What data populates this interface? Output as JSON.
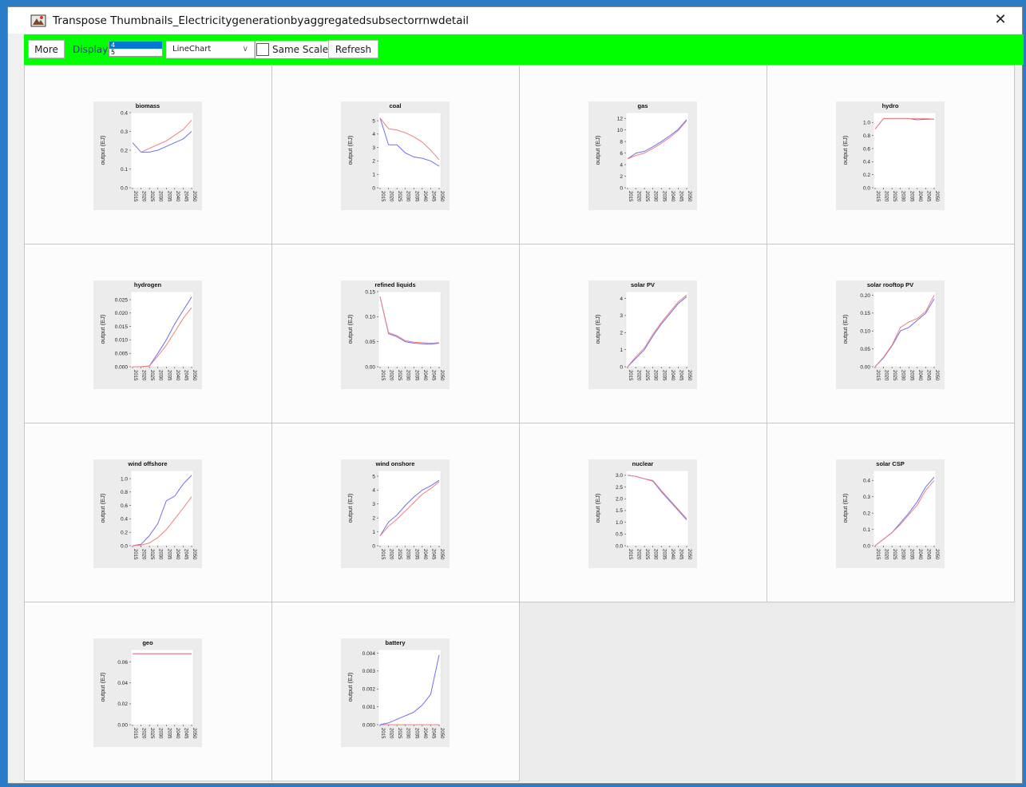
{
  "window": {
    "title": "Transpose Thumbnails_Electricitygenerationbyaggregatedsubsectorrnwdetail",
    "close_glyph": "✕"
  },
  "toolbar": {
    "more_label": "More",
    "display_label": "Display",
    "display_options": [
      "4",
      "5"
    ],
    "display_selected": "4",
    "chart_type": "LineChart",
    "same_scale_label": "Same Scale",
    "same_scale_checked": false,
    "refresh_label": "Refresh",
    "background_color": "#00ff00"
  },
  "chart_data": [
    {
      "type": "line",
      "title": "biomass",
      "ylabel": "output (EJ)",
      "x": [
        "2015",
        "2020",
        "2025",
        "2030",
        "2035",
        "2040",
        "2045",
        "2050"
      ],
      "yticks": [
        "0.0",
        "0.1",
        "0.2",
        "0.3",
        "0.4"
      ],
      "ylim": [
        0,
        0.4
      ],
      "series": [
        {
          "color": "#6f6fee",
          "values": [
            0.24,
            0.19,
            0.19,
            0.2,
            0.22,
            0.24,
            0.26,
            0.3
          ]
        },
        {
          "color": "#f08080",
          "values": [
            null,
            0.19,
            0.21,
            0.23,
            0.25,
            0.28,
            0.31,
            0.36
          ]
        }
      ]
    },
    {
      "type": "line",
      "title": "coal",
      "ylabel": "output (EJ)",
      "x": [
        "2015",
        "2020",
        "2025",
        "2030",
        "2035",
        "2040",
        "2045",
        "2050"
      ],
      "yticks": [
        "0",
        "1",
        "2",
        "3",
        "4",
        "5"
      ],
      "ylim": [
        0,
        5.6
      ],
      "series": [
        {
          "color": "#6f6fee",
          "values": [
            5.2,
            3.2,
            3.2,
            2.6,
            2.3,
            2.2,
            2.0,
            1.6
          ]
        },
        {
          "color": "#f08080",
          "values": [
            5.2,
            4.4,
            4.3,
            4.1,
            3.8,
            3.4,
            2.8,
            2.1
          ]
        }
      ]
    },
    {
      "type": "line",
      "title": "gas",
      "ylabel": "output (EJ)",
      "x": [
        "2015",
        "2020",
        "2025",
        "2030",
        "2035",
        "2040",
        "2045",
        "2050"
      ],
      "yticks": [
        "0",
        "2",
        "4",
        "6",
        "8",
        "10",
        "12"
      ],
      "ylim": [
        0,
        13
      ],
      "series": [
        {
          "color": "#6f6fee",
          "values": [
            5.0,
            6.0,
            6.3,
            7.1,
            8.0,
            9.0,
            10.1,
            11.8
          ]
        },
        {
          "color": "#f08080",
          "values": [
            5.0,
            5.6,
            6.0,
            6.8,
            7.7,
            8.7,
            9.9,
            11.6
          ]
        }
      ]
    },
    {
      "type": "line",
      "title": "hydro",
      "ylabel": "output (EJ)",
      "x": [
        "2015",
        "2020",
        "2025",
        "2030",
        "2035",
        "2040",
        "2045",
        "2050"
      ],
      "yticks": [
        "0.0",
        "0.2",
        "0.4",
        "0.6",
        "0.8",
        "1.0"
      ],
      "ylim": [
        0,
        1.15
      ],
      "series": [
        {
          "color": "#6f6fee",
          "values": [
            0.9,
            1.06,
            1.06,
            1.06,
            1.06,
            1.04,
            1.05,
            1.05
          ]
        },
        {
          "color": "#f08080",
          "values": [
            0.9,
            1.06,
            1.06,
            1.06,
            1.06,
            1.06,
            1.06,
            1.05
          ]
        }
      ]
    },
    {
      "type": "line",
      "title": "hydrogen",
      "ylabel": "output (EJ)",
      "x": [
        "2015",
        "2020",
        "2025",
        "2030",
        "2035",
        "2040",
        "2045",
        "2050"
      ],
      "yticks": [
        "0.000",
        "0.005",
        "0.010",
        "0.015",
        "0.020",
        "0.025"
      ],
      "ylim": [
        0,
        0.028
      ],
      "series": [
        {
          "color": "#6f6fee",
          "values": [
            0,
            0,
            0.0003,
            0.005,
            0.01,
            0.016,
            0.021,
            0.026
          ]
        },
        {
          "color": "#f08080",
          "values": [
            0,
            0,
            0.0002,
            0.004,
            0.008,
            0.013,
            0.018,
            0.022
          ]
        }
      ]
    },
    {
      "type": "line",
      "title": "refined liquids",
      "ylabel": "output (EJ)",
      "x": [
        "2015",
        "2020",
        "2025",
        "2030",
        "2035",
        "2040",
        "2045",
        "2050"
      ],
      "yticks": [
        "0.00",
        "0.05",
        "0.10",
        "0.15"
      ],
      "ylim": [
        0,
        0.15
      ],
      "series": [
        {
          "color": "#6f6fee",
          "values": [
            0.14,
            0.066,
            0.06,
            0.05,
            0.047,
            0.046,
            0.045,
            0.047
          ]
        },
        {
          "color": "#f08080",
          "values": [
            0.14,
            0.068,
            0.062,
            0.052,
            0.049,
            0.048,
            0.047,
            0.048
          ]
        }
      ]
    },
    {
      "type": "line",
      "title": "solar PV",
      "ylabel": "output (EJ)",
      "x": [
        "2015",
        "2020",
        "2025",
        "2030",
        "2035",
        "2040",
        "2045",
        "2050"
      ],
      "yticks": [
        "0",
        "1",
        "2",
        "3",
        "4"
      ],
      "ylim": [
        0,
        4.4
      ],
      "series": [
        {
          "color": "#6f6fee",
          "values": [
            0,
            0.5,
            1.0,
            1.8,
            2.5,
            3.1,
            3.7,
            4.1
          ]
        },
        {
          "color": "#f08080",
          "values": [
            0,
            0.6,
            1.1,
            1.9,
            2.6,
            3.2,
            3.8,
            4.2
          ]
        }
      ]
    },
    {
      "type": "line",
      "title": "solar rooftop PV",
      "ylabel": "output (EJ)",
      "x": [
        "2015",
        "2020",
        "2025",
        "2030",
        "2035",
        "2040",
        "2045",
        "2050"
      ],
      "yticks": [
        "0.00",
        "0.05",
        "0.10",
        "0.15",
        "0.20"
      ],
      "ylim": [
        0,
        0.21
      ],
      "series": [
        {
          "color": "#6f6fee",
          "values": [
            0,
            0.025,
            0.058,
            0.1,
            0.11,
            0.13,
            0.15,
            0.19
          ]
        },
        {
          "color": "#f08080",
          "values": [
            0,
            0.027,
            0.06,
            0.11,
            0.125,
            0.135,
            0.155,
            0.2
          ]
        }
      ]
    },
    {
      "type": "line",
      "title": "wind offshore",
      "ylabel": "output (EJ)",
      "x": [
        "2015",
        "2020",
        "2025",
        "2030",
        "2035",
        "2040",
        "2045",
        "2050"
      ],
      "yticks": [
        "0.0",
        "0.2",
        "0.4",
        "0.6",
        "0.8",
        "1.0"
      ],
      "ylim": [
        0,
        1.12
      ],
      "series": [
        {
          "color": "#6f6fee",
          "values": [
            0,
            0.02,
            0.15,
            0.33,
            0.67,
            0.74,
            0.92,
            1.05
          ]
        },
        {
          "color": "#f08080",
          "values": [
            0,
            0.01,
            0.04,
            0.12,
            0.24,
            0.4,
            0.56,
            0.73
          ]
        }
      ]
    },
    {
      "type": "line",
      "title": "wind onshore",
      "ylabel": "output (EJ)",
      "x": [
        "2015",
        "2020",
        "2025",
        "2030",
        "2035",
        "2040",
        "2045",
        "2050"
      ],
      "yticks": [
        "0",
        "1",
        "2",
        "3",
        "4",
        "5"
      ],
      "ylim": [
        0,
        5.4
      ],
      "series": [
        {
          "color": "#6f6fee",
          "values": [
            0.7,
            1.7,
            2.2,
            2.9,
            3.5,
            4.0,
            4.3,
            4.7
          ]
        },
        {
          "color": "#f08080",
          "values": [
            0.7,
            1.4,
            1.9,
            2.5,
            3.1,
            3.7,
            4.1,
            4.6
          ]
        }
      ]
    },
    {
      "type": "line",
      "title": "nuclear",
      "ylabel": "output (EJ)",
      "x": [
        "2015",
        "2020",
        "2025",
        "2030",
        "2035",
        "2040",
        "2045",
        "2050"
      ],
      "yticks": [
        "0.0",
        "0.5",
        "1.0",
        "1.5",
        "2.0",
        "2.5",
        "3.0"
      ],
      "ylim": [
        0,
        3.2
      ],
      "series": [
        {
          "color": "#6f6fee",
          "values": [
            3.0,
            2.95,
            2.85,
            2.75,
            2.3,
            1.9,
            1.5,
            1.1
          ]
        },
        {
          "color": "#f08080",
          "values": [
            3.0,
            2.95,
            2.85,
            2.78,
            2.35,
            1.95,
            1.55,
            1.15
          ]
        }
      ]
    },
    {
      "type": "line",
      "title": "solar CSP",
      "ylabel": "output (EJ)",
      "x": [
        "2015",
        "2020",
        "2025",
        "2030",
        "2035",
        "2040",
        "2045",
        "2050"
      ],
      "yticks": [
        "0.0",
        "0.1",
        "0.2",
        "0.3",
        "0.4"
      ],
      "ylim": [
        0,
        0.46
      ],
      "series": [
        {
          "color": "#6f6fee",
          "values": [
            0,
            0.04,
            0.08,
            0.14,
            0.2,
            0.27,
            0.36,
            0.42
          ]
        },
        {
          "color": "#f08080",
          "values": [
            0,
            0.04,
            0.08,
            0.13,
            0.19,
            0.25,
            0.34,
            0.4
          ]
        }
      ]
    },
    {
      "type": "line",
      "title": "geo",
      "ylabel": "output (EJ)",
      "x": [
        "2015",
        "2020",
        "2025",
        "2030",
        "2035",
        "2040",
        "2045",
        "2050"
      ],
      "yticks": [
        "0.00",
        "0.02",
        "0.04",
        "0.06"
      ],
      "ylim": [
        0,
        0.072
      ],
      "series": [
        {
          "color": "#6f6fee",
          "values": [
            0.068,
            0.068,
            0.068,
            0.068,
            0.068,
            0.068,
            0.068,
            0.068
          ]
        },
        {
          "color": "#f08080",
          "values": [
            0.068,
            0.068,
            0.068,
            0.068,
            0.068,
            0.068,
            0.068,
            0.068
          ]
        }
      ]
    },
    {
      "type": "line",
      "title": "battery",
      "ylabel": "output (EJ)",
      "x": [
        "2015",
        "2020",
        "2025",
        "2030",
        "2035",
        "2040",
        "2045",
        "2050"
      ],
      "yticks": [
        "0.000",
        "0.001",
        "0.002",
        "0.003",
        "0.004"
      ],
      "ylim": [
        0,
        0.0042
      ],
      "series": [
        {
          "color": "#f08080",
          "values": [
            0,
            0,
            0,
            0,
            0,
            0,
            0,
            0
          ]
        },
        {
          "color": "#6f6fee",
          "values": [
            0,
            0.0001,
            0.0003,
            0.0005,
            0.0007,
            0.0011,
            0.0017,
            0.0039
          ]
        }
      ]
    }
  ]
}
